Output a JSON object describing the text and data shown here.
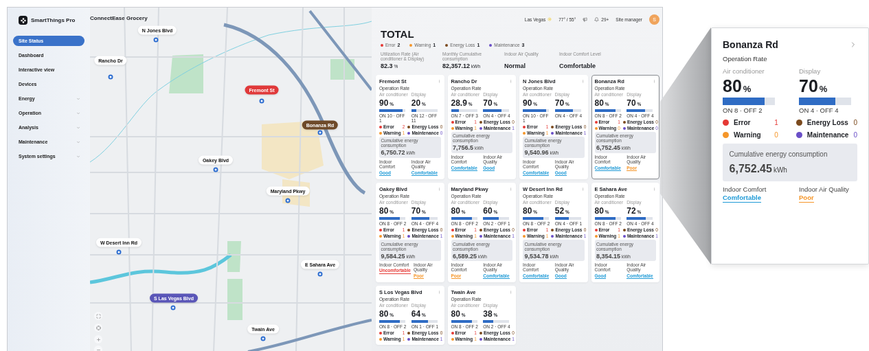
{
  "app": {
    "name": "SmartThings Pro"
  },
  "sidebar": {
    "items": [
      {
        "label": "Site Status",
        "selected": true,
        "kind": "link"
      },
      {
        "label": "Dashboard",
        "selected": false,
        "kind": "link"
      },
      {
        "label": "Interactive view",
        "selected": false,
        "kind": "link"
      },
      {
        "label": "Devices",
        "selected": false,
        "kind": "link"
      },
      {
        "label": "Energy",
        "selected": false,
        "kind": "group"
      },
      {
        "label": "Operation",
        "selected": false,
        "kind": "group"
      },
      {
        "label": "Analysis",
        "selected": false,
        "kind": "group"
      },
      {
        "label": "Maintenance",
        "selected": false,
        "kind": "group"
      },
      {
        "label": "System settings",
        "selected": false,
        "kind": "group"
      }
    ]
  },
  "map": {
    "title": "ConnectEase Grocery",
    "pins": [
      {
        "label": "N Jones Blvd",
        "kind": "normal"
      },
      {
        "label": "Rancho Dr",
        "kind": "normal"
      },
      {
        "label": "Fremont St",
        "kind": "error"
      },
      {
        "label": "Bonanza Rd",
        "kind": "energy_loss"
      },
      {
        "label": "Oakey Blvd",
        "kind": "normal"
      },
      {
        "label": "Maryland Pkwy",
        "kind": "normal"
      },
      {
        "label": "W Desert Inn Rd",
        "kind": "normal"
      },
      {
        "label": "E Sahara Ave",
        "kind": "normal"
      },
      {
        "label": "S Las Vegas Blvd",
        "kind": "maintenance"
      },
      {
        "label": "Twain Ave",
        "kind": "normal"
      }
    ]
  },
  "header": {
    "city": "Las Vegas",
    "temperature": "77° / 55°",
    "notifications": "29+",
    "user_role": "Site manager",
    "avatar": "S"
  },
  "total": {
    "title": "TOTAL",
    "alerts": [
      {
        "label": "Error",
        "count": "2",
        "color": "#e53935"
      },
      {
        "label": "Warning",
        "count": "1",
        "color": "#f5962a"
      },
      {
        "label": "Energy Loss",
        "count": "1",
        "color": "#7b4a1e"
      },
      {
        "label": "Maintenance",
        "count": "3",
        "color": "#6a4fc7"
      }
    ],
    "metrics": [
      {
        "label": "Utilization Rate (Air conditioner & Display)",
        "value": "82.3",
        "unit": "%"
      },
      {
        "label": "Monthly Cumulative consumption",
        "value": "82,357.12",
        "unit": "kWh"
      },
      {
        "label": "Indoor Air Quality",
        "value": "Normal"
      },
      {
        "label": "Indoor Comfort Level",
        "value": "Comfortable"
      }
    ]
  },
  "cards": [
    {
      "name": "Fremont St",
      "highlighted": false,
      "rate_label": "Operation Rate",
      "meters": [
        {
          "label": "Air conditioner",
          "value": "90",
          "unit": "%",
          "level": 0.9,
          "counts": "ON 10 · OFF 1"
        },
        {
          "label": "Display",
          "value": "20",
          "unit": "%",
          "level": 0.2,
          "counts": "ON 12 · OFF 11"
        }
      ],
      "statuses": [
        {
          "label": "Error",
          "count": "2",
          "color": "#e53935"
        },
        {
          "label": "Energy Loss",
          "count": "0",
          "color": "#7b4a1e"
        },
        {
          "label": "Warning",
          "count": "1",
          "color": "#f5962a"
        },
        {
          "label": "Maintenance",
          "count": "0",
          "color": "#6a4fc7"
        }
      ],
      "energy": {
        "label": "Cumulative energy consumption",
        "value": "6,750.72",
        "unit": "kWh"
      },
      "indoor": [
        {
          "label": "Indoor Comfort",
          "value": "Good",
          "color": "#1f9ad6"
        },
        {
          "label": "Indoor Air Quality",
          "value": "Comfortable",
          "color": "#1f9ad6"
        }
      ]
    },
    {
      "name": "Rancho Dr",
      "highlighted": false,
      "rate_label": "Operation Rate",
      "meters": [
        {
          "label": "Air conditioner",
          "value": "28.9",
          "unit": "%",
          "level": 0.29,
          "counts": "ON 7 · OFF 3"
        },
        {
          "label": "Display",
          "value": "70",
          "unit": "%",
          "level": 0.7,
          "counts": "ON 4 · OFF 4"
        }
      ],
      "statuses": [
        {
          "label": "Error",
          "count": "1",
          "color": "#e53935"
        },
        {
          "label": "Energy Loss",
          "count": "0",
          "color": "#7b4a1e"
        },
        {
          "label": "Warning",
          "count": "1",
          "color": "#f5962a"
        },
        {
          "label": "Maintenance",
          "count": "1",
          "color": "#6a4fc7"
        }
      ],
      "energy": {
        "label": "Cumulative energy consumption",
        "value": "7,756.5",
        "unit": "kWh"
      },
      "indoor": [
        {
          "label": "Indoor Comfort",
          "value": "Comfortable",
          "color": "#1f9ad6"
        },
        {
          "label": "Indoor Air Quality",
          "value": "Good",
          "color": "#1f9ad6"
        }
      ]
    },
    {
      "name": "N Jones Blvd",
      "highlighted": false,
      "rate_label": "Operation Rate",
      "meters": [
        {
          "label": "Air conditioner",
          "value": "90",
          "unit": "%",
          "level": 0.9,
          "counts": "ON 10 · OFF 1"
        },
        {
          "label": "Display",
          "value": "70",
          "unit": "%",
          "level": 0.7,
          "counts": "ON 4 · OFF 4"
        }
      ],
      "statuses": [
        {
          "label": "Error",
          "count": "1",
          "color": "#e53935"
        },
        {
          "label": "Energy Loss",
          "count": "0",
          "color": "#7b4a1e"
        },
        {
          "label": "Warning",
          "count": "1",
          "color": "#f5962a"
        },
        {
          "label": "Maintenance",
          "count": "1",
          "color": "#6a4fc7"
        }
      ],
      "energy": {
        "label": "Cumulative energy consumption",
        "value": "9,540.96",
        "unit": "kWh"
      },
      "indoor": [
        {
          "label": "Indoor Comfort",
          "value": "Comfortable",
          "color": "#1f9ad6"
        },
        {
          "label": "Indoor Air Quality",
          "value": "Good",
          "color": "#1f9ad6"
        }
      ]
    },
    {
      "name": "Bonanza Rd",
      "highlighted": true,
      "rate_label": "Operation Rate",
      "meters": [
        {
          "label": "Air conditioner",
          "value": "80",
          "unit": "%",
          "level": 0.8,
          "counts": "ON 8 · OFF 2"
        },
        {
          "label": "Display",
          "value": "70",
          "unit": "%",
          "level": 0.7,
          "counts": "ON 4 · OFF 4"
        }
      ],
      "statuses": [
        {
          "label": "Error",
          "count": "1",
          "color": "#e53935"
        },
        {
          "label": "Energy Loss",
          "count": "0",
          "color": "#7b4a1e"
        },
        {
          "label": "Warning",
          "count": "0",
          "color": "#f5962a"
        },
        {
          "label": "Maintenance",
          "count": "0",
          "color": "#6a4fc7"
        }
      ],
      "energy": {
        "label": "Cumulative energy consumption",
        "value": "6,752.45",
        "unit": "kWh"
      },
      "indoor": [
        {
          "label": "Indoor Comfort",
          "value": "Comfortable",
          "color": "#1f9ad6"
        },
        {
          "label": "Indoor Air Quality",
          "value": "Poor",
          "color": "#f5962a"
        }
      ]
    },
    {
      "name": "Oakey Blvd",
      "highlighted": false,
      "rate_label": "Operation Rate",
      "meters": [
        {
          "label": "Air conditioner",
          "value": "80",
          "unit": "%",
          "level": 0.8,
          "counts": "ON 8 · OFF 2"
        },
        {
          "label": "Display",
          "value": "70",
          "unit": "%",
          "level": 0.7,
          "counts": "ON 4 · OFF 4"
        }
      ],
      "statuses": [
        {
          "label": "Error",
          "count": "1",
          "color": "#e53935"
        },
        {
          "label": "Energy Loss",
          "count": "0",
          "color": "#7b4a1e"
        },
        {
          "label": "Warning",
          "count": "1",
          "color": "#f5962a"
        },
        {
          "label": "Maintenance",
          "count": "1",
          "color": "#6a4fc7"
        }
      ],
      "energy": {
        "label": "Cumulative energy consumption",
        "value": "9,584.25",
        "unit": "kWh"
      },
      "indoor": [
        {
          "label": "Indoor Comfort",
          "value": "Uncomfortable",
          "color": "#e53935"
        },
        {
          "label": "Indoor Air Quality",
          "value": "Poor",
          "color": "#f5962a"
        }
      ]
    },
    {
      "name": "Maryland Pkwy",
      "highlighted": false,
      "rate_label": "Operation Rate",
      "meters": [
        {
          "label": "Air conditioner",
          "value": "80",
          "unit": "%",
          "level": 0.8,
          "counts": "ON 8 · OFF 2"
        },
        {
          "label": "Display",
          "value": "60",
          "unit": "%",
          "level": 0.6,
          "counts": "ON 2 · OFF 1"
        }
      ],
      "statuses": [
        {
          "label": "Error",
          "count": "1",
          "color": "#e53935"
        },
        {
          "label": "Energy Loss",
          "count": "0",
          "color": "#7b4a1e"
        },
        {
          "label": "Warning",
          "count": "1",
          "color": "#f5962a"
        },
        {
          "label": "Maintenance",
          "count": "1",
          "color": "#6a4fc7"
        }
      ],
      "energy": {
        "label": "Cumulative energy consumption",
        "value": "6,589.25",
        "unit": "kWh"
      },
      "indoor": [
        {
          "label": "Indoor Comfort",
          "value": "Poor",
          "color": "#f5962a"
        },
        {
          "label": "Indoor Air Quality",
          "value": "Comfortable",
          "color": "#1f9ad6"
        }
      ]
    },
    {
      "name": "W Desert Inn Rd",
      "highlighted": false,
      "rate_label": "Operation Rate",
      "meters": [
        {
          "label": "Air conditioner",
          "value": "80",
          "unit": "%",
          "level": 0.8,
          "counts": "ON 8 · OFF 2"
        },
        {
          "label": "Display",
          "value": "52",
          "unit": "%",
          "level": 0.52,
          "counts": "ON 4 · OFF 1"
        }
      ],
      "statuses": [
        {
          "label": "Error",
          "count": "1",
          "color": "#e53935"
        },
        {
          "label": "Energy Loss",
          "count": "0",
          "color": "#7b4a1e"
        },
        {
          "label": "Warning",
          "count": "1",
          "color": "#f5962a"
        },
        {
          "label": "Maintenance",
          "count": "1",
          "color": "#6a4fc7"
        }
      ],
      "energy": {
        "label": "Cumulative energy consumption",
        "value": "9,534.78",
        "unit": "kWh"
      },
      "indoor": [
        {
          "label": "Indoor Comfort",
          "value": "Comfortable",
          "color": "#1f9ad6"
        },
        {
          "label": "Indoor Air Quality",
          "value": "Good",
          "color": "#1f9ad6"
        }
      ]
    },
    {
      "name": "E Sahara Ave",
      "highlighted": false,
      "rate_label": "Operation Rate",
      "meters": [
        {
          "label": "Air conditioner",
          "value": "80",
          "unit": "%",
          "level": 0.8,
          "counts": "ON 8 · OFF 2"
        },
        {
          "label": "Display",
          "value": "72",
          "unit": "%",
          "level": 0.72,
          "counts": "ON 4 · OFF 4"
        }
      ],
      "statuses": [
        {
          "label": "Error",
          "count": "1",
          "color": "#e53935"
        },
        {
          "label": "Energy Loss",
          "count": "0",
          "color": "#7b4a1e"
        },
        {
          "label": "Warning",
          "count": "1",
          "color": "#f5962a"
        },
        {
          "label": "Maintenance",
          "count": "1",
          "color": "#6a4fc7"
        }
      ],
      "energy": {
        "label": "Cumulative energy consumption",
        "value": "8,354.15",
        "unit": "kWh"
      },
      "indoor": [
        {
          "label": "Indoor Comfort",
          "value": "Good",
          "color": "#1f9ad6"
        },
        {
          "label": "Indoor Air Quality",
          "value": "Comfortable",
          "color": "#1f9ad6"
        }
      ]
    },
    {
      "name": "S Los Vegas Blvd",
      "highlighted": false,
      "rate_label": "Operation Rate",
      "meters": [
        {
          "label": "Air conditioner",
          "value": "80",
          "unit": "%",
          "level": 0.8,
          "counts": "ON 8 · OFF 2"
        },
        {
          "label": "Display",
          "value": "64",
          "unit": "%",
          "level": 0.64,
          "counts": "ON 1 · OFF 1"
        }
      ],
      "statuses": [
        {
          "label": "Error",
          "count": "1",
          "color": "#e53935"
        },
        {
          "label": "Energy Loss",
          "count": "0",
          "color": "#7b4a1e"
        },
        {
          "label": "Warning",
          "count": "1",
          "color": "#f5962a"
        },
        {
          "label": "Maintenance",
          "count": "1",
          "color": "#6a4fc7"
        }
      ]
    },
    {
      "name": "Twain Ave",
      "highlighted": false,
      "rate_label": "Operation Rate",
      "meters": [
        {
          "label": "Air conditioner",
          "value": "80",
          "unit": "%",
          "level": 0.8,
          "counts": "ON 8 · OFF 2"
        },
        {
          "label": "Display",
          "value": "38",
          "unit": "%",
          "level": 0.38,
          "counts": "ON 2 · OFF 4"
        }
      ],
      "statuses": [
        {
          "label": "Error",
          "count": "1",
          "color": "#e53935"
        },
        {
          "label": "Energy Loss",
          "count": "0",
          "color": "#7b4a1e"
        },
        {
          "label": "Warning",
          "count": "1",
          "color": "#f5962a"
        },
        {
          "label": "Maintenance",
          "count": "1",
          "color": "#6a4fc7"
        }
      ]
    }
  ],
  "detail": {
    "name": "Bonanza Rd",
    "highlighted": false,
    "rate_label": "Operation Rate",
    "meters": [
      {
        "label": "Air conditioner",
        "value": "80",
        "unit": "%",
        "level": 0.8,
        "counts": "ON 8 · OFF 2"
      },
      {
        "label": "Display",
        "value": "70",
        "unit": "%",
        "level": 0.7,
        "counts": "ON 4 · OFF 4"
      }
    ],
    "statuses": [
      {
        "label": "Error",
        "count": "1",
        "color": "#e53935"
      },
      {
        "label": "Energy Loss",
        "count": "0",
        "color": "#7b4a1e"
      },
      {
        "label": "Warning",
        "count": "0",
        "color": "#f5962a"
      },
      {
        "label": "Maintenance",
        "count": "0",
        "color": "#6a4fc7"
      }
    ],
    "energy": {
      "label": "Cumulative energy consumption",
      "value": "6,752.45",
      "unit": "kWh"
    },
    "indoor": [
      {
        "label": "Indoor Comfort",
        "value": "Comfortable",
        "color": "#1f9ad6"
      },
      {
        "label": "Indoor Air Quality",
        "value": "Poor",
        "color": "#f5962a"
      }
    ]
  }
}
